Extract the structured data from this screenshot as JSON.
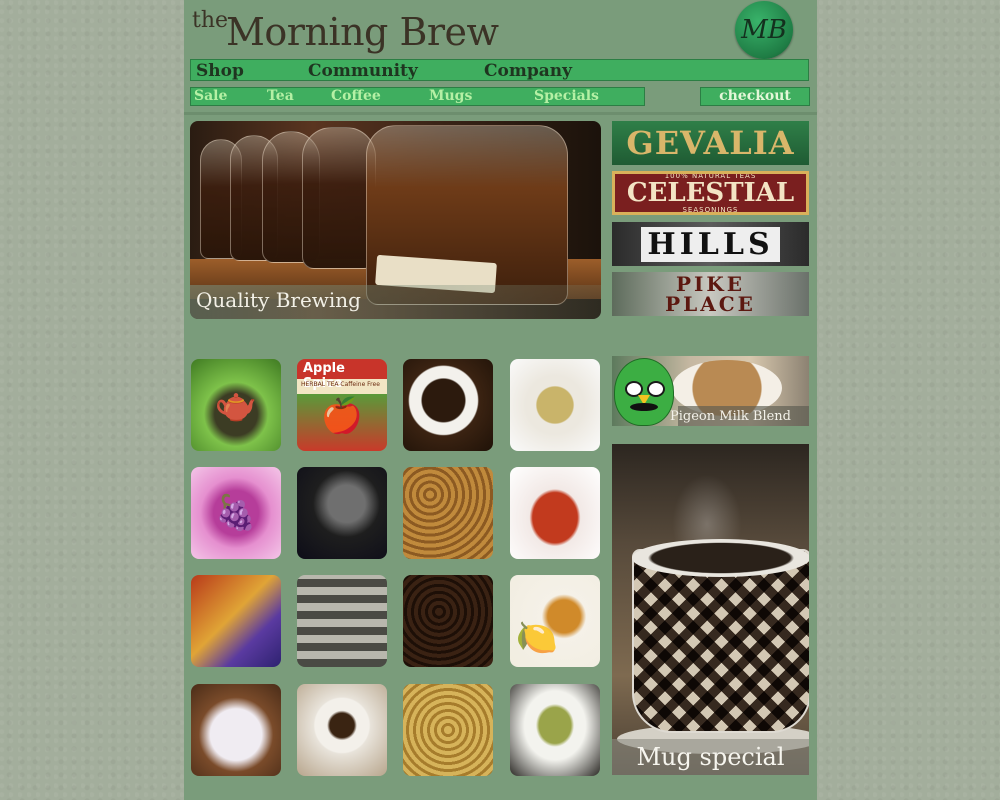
{
  "header": {
    "logo_prefix": "the",
    "logo_name": "Morning Brew",
    "badge_text": "MB"
  },
  "nav_main": [
    "Shop",
    "Community",
    "Company"
  ],
  "nav_sub": [
    "Sale",
    "Tea",
    "Coffee",
    "Mugs",
    "Specials"
  ],
  "checkout_label": "checkout",
  "hero": {
    "caption": "Quality Brewing"
  },
  "brands": {
    "gevalia": "GEVALIA",
    "celestial": "CELESTIAL",
    "celestial_top": "100% NATURAL TEAS",
    "celestial_bottom": "SEASONINGS",
    "hills": "HILLS",
    "pike_line1": "PIKE",
    "pike_line2": "PLACE"
  },
  "tiles": {
    "apple_spice_title": "Apple Spice",
    "apple_spice_sub": "HERBAL TEA  Caffeine Free"
  },
  "promo": {
    "pigeon_caption": "Pigeon Milk Blend",
    "mug_caption": "Mug special"
  },
  "colors": {
    "nav_bar": "#3fae5f",
    "page_bg": "#7a9c7b",
    "body_bg": "#a3ae9c"
  }
}
